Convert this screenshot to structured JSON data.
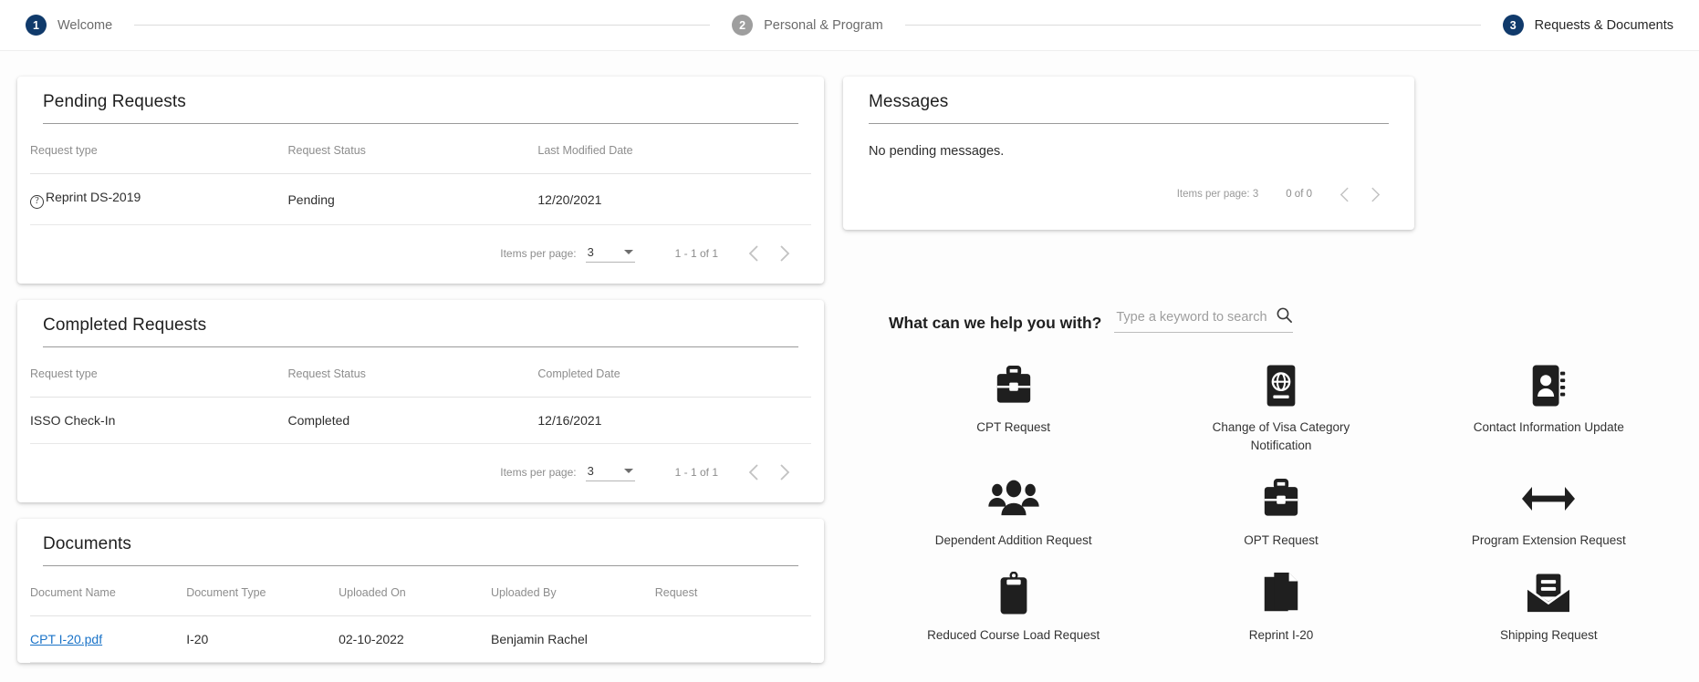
{
  "stepper": {
    "steps": [
      {
        "num": "1",
        "label": "Welcome",
        "state": "inactive"
      },
      {
        "num": "2",
        "label": "Personal & Program",
        "state": "inactive"
      },
      {
        "num": "3",
        "label": "Requests & Documents",
        "state": "active"
      }
    ],
    "active_color": "#103a6b",
    "inactive_color": "#9e9e9e"
  },
  "pending_requests": {
    "title": "Pending Requests",
    "columns": [
      "Request type",
      "Request Status",
      "Last Modified Date"
    ],
    "rows": [
      {
        "type": "Reprint DS-2019",
        "status": "Pending",
        "date": "12/20/2021",
        "icon": "help-circle-icon"
      }
    ],
    "paginator": {
      "items_per_page_label": "Items per page:",
      "items_per_page_value": "3",
      "range": "1 - 1 of 1",
      "prev": "chevron-left-icon",
      "next": "chevron-right-icon"
    }
  },
  "completed_requests": {
    "title": "Completed Requests",
    "columns": [
      "Request type",
      "Request Status",
      "Completed Date"
    ],
    "rows": [
      {
        "type": "ISSO Check-In",
        "status": "Completed",
        "date": "12/16/2021"
      }
    ],
    "paginator": {
      "items_per_page_label": "Items per page:",
      "items_per_page_value": "3",
      "range": "1 - 1 of 1",
      "prev": "chevron-left-icon",
      "next": "chevron-right-icon"
    }
  },
  "documents": {
    "title": "Documents",
    "columns": [
      "Document Name",
      "Document Type",
      "Uploaded On",
      "Uploaded By",
      "Request"
    ],
    "rows": [
      {
        "name": "CPT I-20.pdf",
        "type": "I-20",
        "uploaded_on": "02-10-2022",
        "uploaded_by": "Benjamin Rachel",
        "request": "",
        "link_color": "#1a73c8"
      }
    ]
  },
  "messages": {
    "title": "Messages",
    "empty_text": "No pending messages.",
    "paginator": {
      "items_per_page_label": "Items per page:",
      "items_per_page_value": "3",
      "range": "0 of 0",
      "prev": "chevron-left-icon",
      "next": "chevron-right-icon"
    }
  },
  "help_search": {
    "title": "What can we help you with?",
    "placeholder": "Type a keyword to search",
    "value": "",
    "icon": "search-icon"
  },
  "services": [
    {
      "label": "CPT Request",
      "icon": "briefcase-icon"
    },
    {
      "label": "Change of Visa Category Notification",
      "icon": "passport-globe-icon"
    },
    {
      "label": "Contact Information Update",
      "icon": "contact-card-icon"
    },
    {
      "label": "Dependent Addition Request",
      "icon": "people-group-icon"
    },
    {
      "label": "OPT Request",
      "icon": "briefcase-icon"
    },
    {
      "label": "Program Extension Request",
      "icon": "double-arrow-icon"
    },
    {
      "label": "Reduced Course Load Request",
      "icon": "clipboard-icon"
    },
    {
      "label": "Reprint I-20",
      "icon": "copy-documents-icon"
    },
    {
      "label": "Shipping Request",
      "icon": "open-envelope-icon"
    }
  ]
}
